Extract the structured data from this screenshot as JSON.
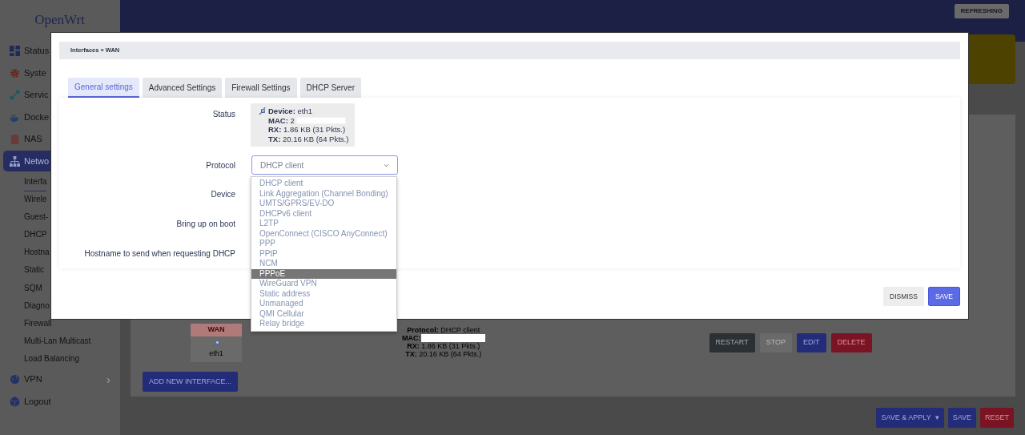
{
  "sidebar": {
    "logo": "OpenWrt",
    "items": [
      {
        "label": "Status",
        "kind": "grid",
        "selected": false
      },
      {
        "label": "Syste",
        "kind": "gear",
        "selected": false
      },
      {
        "label": "Servic",
        "kind": "nodes",
        "selected": false
      },
      {
        "label": "Docke",
        "kind": "whale",
        "selected": false
      },
      {
        "label": "NAS",
        "kind": "disk",
        "selected": false
      },
      {
        "label": "Netwo",
        "kind": "network",
        "selected": true,
        "children": [
          {
            "label": "Interfa",
            "selected": true
          },
          {
            "label": "Wirele",
            "selected": false
          },
          {
            "label": "Guest-",
            "selected": false
          },
          {
            "label": "DHCP",
            "selected": false
          },
          {
            "label": "Hostna",
            "selected": false
          },
          {
            "label": "Static",
            "selected": false
          },
          {
            "label": "SQM",
            "selected": false
          },
          {
            "label": "Diagno",
            "selected": false
          },
          {
            "label": "Firewall",
            "selected": false
          },
          {
            "label": "Multi-Lan Multicast",
            "selected": false
          },
          {
            "label": "Load Balancing",
            "selected": false
          }
        ]
      },
      {
        "label": "VPN",
        "kind": "globe",
        "selected": false,
        "arrow": "›"
      },
      {
        "label": "Logout",
        "kind": "cube",
        "selected": false
      }
    ]
  },
  "header": {
    "badge": "REFRESHING"
  },
  "interface_row": {
    "name": "WAN",
    "device": "eth1",
    "protocol_label": "Protocol:",
    "protocol": "DHCP client",
    "mac_label": "MAC:",
    "rx_label": "RX:",
    "rx": "1.86 KB (31 Pkts.)",
    "tx_label": "TX:",
    "tx": "20.16 KB (64 Pkts.)",
    "buttons": [
      {
        "label": "RESTART",
        "kind": "dark"
      },
      {
        "label": "STOP",
        "kind": "gray"
      },
      {
        "label": "EDIT",
        "kind": "blue"
      },
      {
        "label": "DELETE",
        "kind": "red"
      }
    ]
  },
  "add_button": "ADD NEW INTERFACE...",
  "footer_buttons": [
    {
      "label": "SAVE & APPLY",
      "kind": "blue",
      "caret": "▾"
    },
    {
      "label": "SAVE",
      "kind": "blue"
    },
    {
      "label": "RESET",
      "kind": "red"
    }
  ],
  "modal": {
    "breadcrumb": "Interfaces » WAN",
    "tabs": [
      {
        "label": "General settings",
        "selected": true
      },
      {
        "label": "Advanced Settings",
        "selected": false
      },
      {
        "label": "Firewall Settings",
        "selected": false
      },
      {
        "label": "DHCP Server",
        "selected": false
      }
    ],
    "status": {
      "label": "Status",
      "device_label": "Device:",
      "device": "eth1",
      "mac_label": "MAC:",
      "mac": "2",
      "rx_label": "RX:",
      "rx": "1.86 KB (31 Pkts.)",
      "tx_label": "TX:",
      "tx": "20.16 KB (64 Pkts.)"
    },
    "protocol": {
      "label": "Protocol",
      "value": "DHCP client",
      "options": [
        {
          "label": "DHCP client",
          "highlighted": false
        },
        {
          "label": "Link Aggregation (Channel Bonding)",
          "highlighted": false
        },
        {
          "label": "UMTS/GPRS/EV-DO",
          "highlighted": false
        },
        {
          "label": "DHCPv6 client",
          "highlighted": false
        },
        {
          "label": "L2TP",
          "highlighted": false
        },
        {
          "label": "OpenConnect (CISCO AnyConnect)",
          "highlighted": false
        },
        {
          "label": "PPP",
          "highlighted": false
        },
        {
          "label": "PPtP",
          "highlighted": false
        },
        {
          "label": "NCM",
          "highlighted": false
        },
        {
          "label": "PPPoE",
          "highlighted": true
        },
        {
          "label": "WireGuard VPN",
          "highlighted": false
        },
        {
          "label": "Static address",
          "highlighted": false
        },
        {
          "label": "Unmanaged",
          "highlighted": false
        },
        {
          "label": "QMI Cellular",
          "highlighted": false
        },
        {
          "label": "Relay bridge",
          "highlighted": false
        }
      ]
    },
    "other_fields": [
      "Device",
      "Bring up on boot",
      "Hostname to send when requesting DHCP"
    ],
    "buttons": [
      {
        "label": "DISMISS",
        "kind": "plain"
      },
      {
        "label": "SAVE",
        "kind": "primary"
      }
    ]
  }
}
